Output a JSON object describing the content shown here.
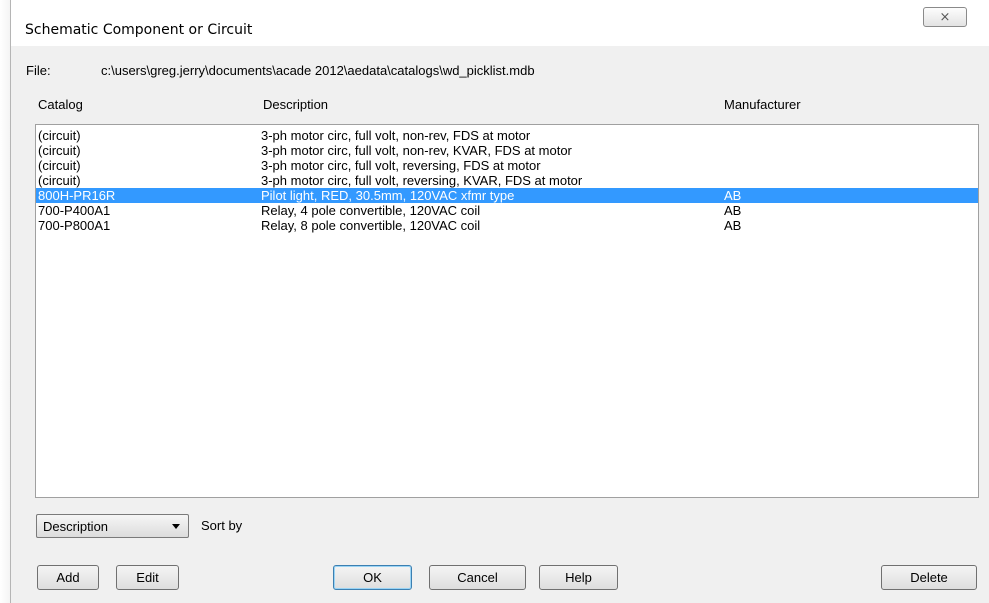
{
  "window": {
    "title": "Schematic Component or Circuit",
    "close_glyph": "⨯"
  },
  "file": {
    "label": "File:",
    "path": "c:\\users\\greg.jerry\\documents\\acade 2012\\aedata\\catalogs\\wd_picklist.mdb"
  },
  "columns": {
    "catalog": "Catalog",
    "description": "Description",
    "manufacturer": "Manufacturer"
  },
  "rows": [
    {
      "catalog": "(circuit)",
      "description": "3-ph motor circ, full volt, non-rev, FDS at motor",
      "manufacturer": ""
    },
    {
      "catalog": "(circuit)",
      "description": "3-ph motor circ, full volt, non-rev, KVAR, FDS at motor",
      "manufacturer": ""
    },
    {
      "catalog": "(circuit)",
      "description": "3-ph motor circ, full volt, reversing, FDS at motor",
      "manufacturer": ""
    },
    {
      "catalog": "(circuit)",
      "description": "3-ph motor circ, full volt, reversing, KVAR, FDS at motor",
      "manufacturer": ""
    },
    {
      "catalog": "800H-PR16R",
      "description": "Pilot light, RED, 30.5mm, 120VAC xfmr type",
      "manufacturer": "AB"
    },
    {
      "catalog": "700-P400A1",
      "description": "Relay, 4 pole convertible, 120VAC coil",
      "manufacturer": "AB"
    },
    {
      "catalog": "700-P800A1",
      "description": "Relay, 8 pole convertible, 120VAC coil",
      "manufacturer": "AB"
    }
  ],
  "selected_index": 4,
  "sort": {
    "selected": "Description",
    "label": "Sort by"
  },
  "buttons": {
    "add": "Add",
    "edit": "Edit",
    "ok": "OK",
    "cancel": "Cancel",
    "help": "Help",
    "delete": "Delete"
  },
  "colors": {
    "selection": "#3399ff",
    "dialog_bg": "#f0f0f0"
  }
}
